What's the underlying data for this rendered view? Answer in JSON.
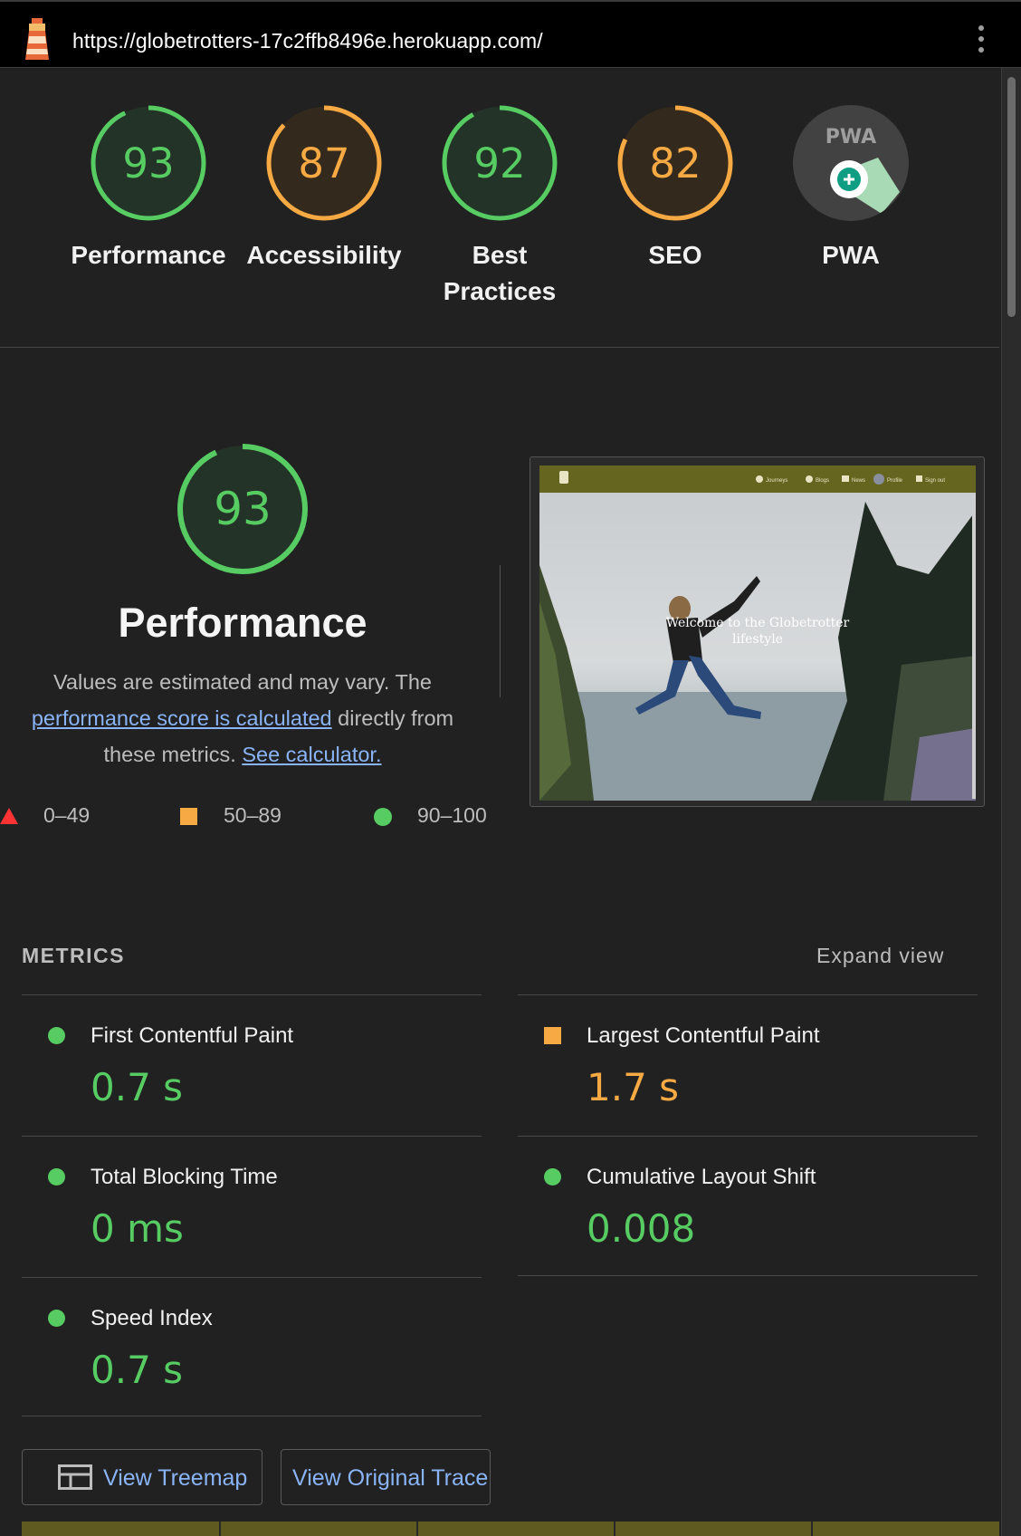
{
  "address_bar": {
    "url": "https://globetrotters-17c2ffb8496e.herokuapp.com/",
    "icon": "lighthouse-icon",
    "menu_icon": "more-vert-icon"
  },
  "summary_gauges": [
    {
      "score": "93",
      "label": "Performance",
      "rating": "pass",
      "color": "#57cc63",
      "fill": 0.93
    },
    {
      "score": "87",
      "label": "Accessibility",
      "rating": "average",
      "color": "#f7a943",
      "fill": 0.87
    },
    {
      "score": "92",
      "label": "Best Practices",
      "label_line1": "Best",
      "label_line2": "Practices",
      "rating": "pass",
      "color": "#57cc63",
      "fill": 0.92
    },
    {
      "score": "82",
      "label": "SEO",
      "rating": "average",
      "color": "#f7a943",
      "fill": 0.82
    },
    {
      "label": "PWA",
      "badge_text": "PWA",
      "icon": "pwa-badge-icon"
    }
  ],
  "performance": {
    "score": "93",
    "fill": 0.93,
    "title": "Performance",
    "desc_part1": "Values are estimated and may vary. The",
    "desc_link1": "performance score is calculated",
    "desc_part2": "directly from these metrics.",
    "desc_link2": "See calculator.",
    "legend": [
      {
        "range": "0–49",
        "icon": "red-triangle-icon",
        "color": "#f33"
      },
      {
        "range": "50–89",
        "icon": "orange-square-icon",
        "color": "#f7a943"
      },
      {
        "range": "90–100",
        "icon": "green-circle-icon",
        "color": "#57cc63"
      }
    ]
  },
  "screenshot": {
    "nav_items": [
      "Journeys",
      "Blogs",
      "News",
      "Profile",
      "Sign out"
    ],
    "hero_text_line1": "Welcome to the Globetrotter",
    "hero_text_line2": "lifestyle"
  },
  "metrics": {
    "header": "METRICS",
    "expand_label": "Expand view",
    "items": [
      {
        "name": "First Contentful Paint",
        "value": "0.7 s",
        "rating": "pass"
      },
      {
        "name": "Largest Contentful Paint",
        "value": "1.7 s",
        "rating": "average"
      },
      {
        "name": "Total Blocking Time",
        "value": "0 ms",
        "rating": "pass"
      },
      {
        "name": "Cumulative Layout Shift",
        "value": "0.008",
        "rating": "pass"
      },
      {
        "name": "Speed Index",
        "value": "0.7 s",
        "rating": "pass"
      }
    ]
  },
  "buttons": {
    "treemap": "View Treemap",
    "trace": "View Original Trace"
  },
  "colors": {
    "pass": "#57cc63",
    "average": "#f7a943",
    "fail": "#ff3333",
    "link": "#8ab4f8",
    "background": "#212121"
  }
}
